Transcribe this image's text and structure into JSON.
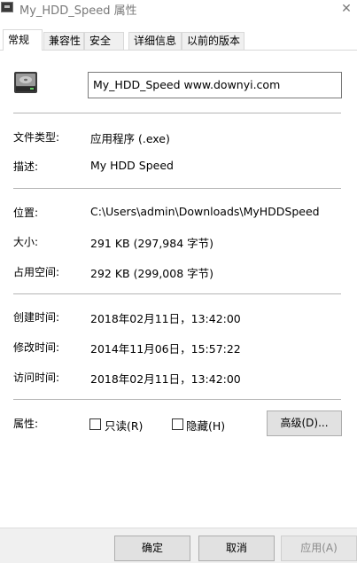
{
  "window": {
    "title": "My_HDD_Speed 属性",
    "close_glyph": "✕"
  },
  "tabs": [
    {
      "label": "常规",
      "active": true
    },
    {
      "label": "兼容性"
    },
    {
      "label": "安全"
    },
    {
      "label": "详细信息"
    },
    {
      "label": "以前的版本"
    }
  ],
  "file": {
    "icon": "hdd-app-icon",
    "name": "My_HDD_Speed     www.downyi.com"
  },
  "general": {
    "type_label": "文件类型:",
    "type_value": "应用程序 (.exe)",
    "desc_label": "描述:",
    "desc_value": "My HDD Speed",
    "location_label": "位置:",
    "location_value": "C:\\Users\\admin\\Downloads\\MyHDDSpeed",
    "size_label": "大小:",
    "size_value": "291 KB (297,984 字节)",
    "disk_label": "占用空间:",
    "disk_value": "292 KB (299,008 字节)",
    "created_label": "创建时间:",
    "created_value": "2018年02月11日，13:42:00",
    "modified_label": "修改时间:",
    "modified_value": "2014年11月06日，15:57:22",
    "accessed_label": "访问时间:",
    "accessed_value": "2018年02月11日，13:42:00",
    "attrs_label": "属性:",
    "readonly_label": "只读(R)",
    "readonly_checked": false,
    "hidden_label": "隐藏(H)",
    "hidden_checked": false,
    "advanced_label": "高级(D)..."
  },
  "buttons": {
    "ok": "确定",
    "cancel": "取消",
    "apply": "应用(A)"
  }
}
